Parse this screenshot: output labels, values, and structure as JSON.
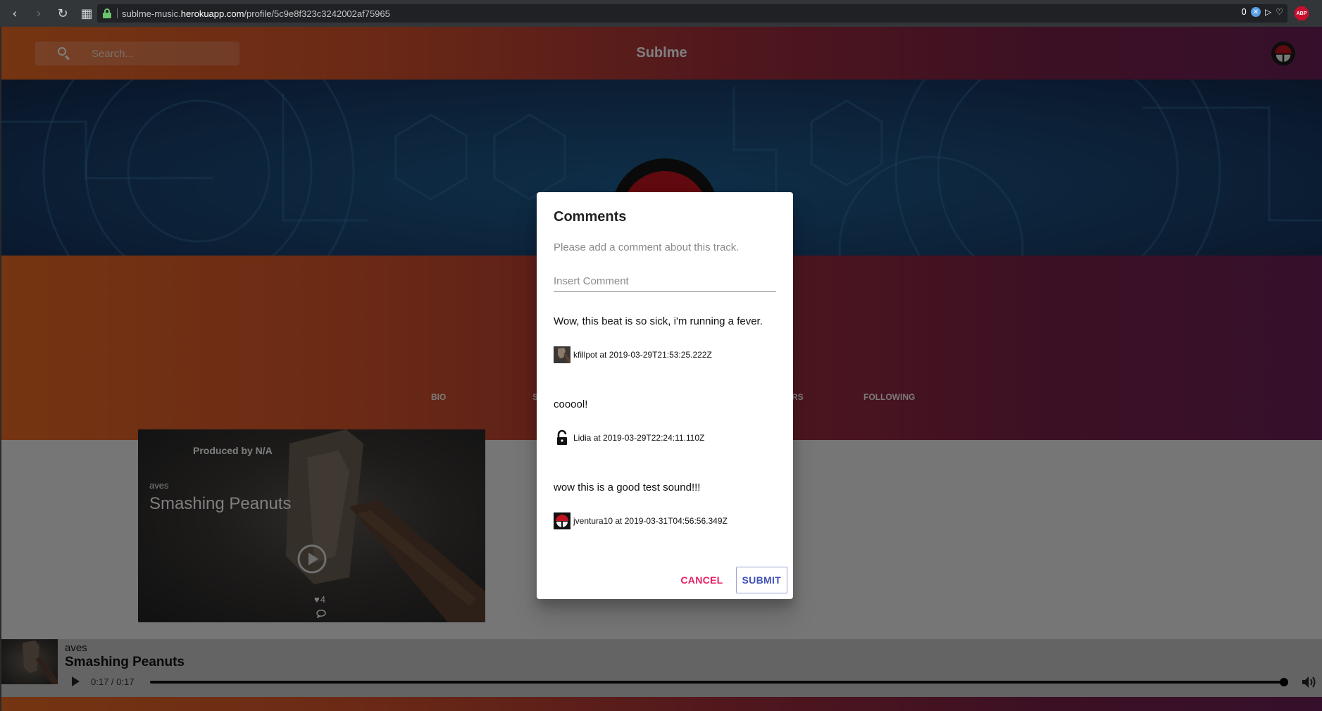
{
  "browser": {
    "url_prefix": "sublme-music.",
    "url_domain": "herokuapp.com",
    "url_path": "/profile/5c9e8f323c3242002af75965",
    "badge_count": "0",
    "abp_label": "ABP"
  },
  "header": {
    "search_placeholder": "Search...",
    "title": "Sublme"
  },
  "profile": {
    "tabs": [
      "BIO",
      "S",
      "RS",
      "FOLLOWING"
    ]
  },
  "track_card": {
    "produced_by": "Produced by N/A",
    "artist": "aves",
    "title": "Smashing Peanuts",
    "likes": "4"
  },
  "player": {
    "artist": "aves",
    "title": "Smashing Peanuts",
    "time": "0:17 / 0:17",
    "progress": 1.0
  },
  "dialog": {
    "title": "Comments",
    "text": "Please add a comment about this track.",
    "input_placeholder": "Insert Comment",
    "comments": [
      {
        "text": "Wow, this beat is so sick, i'm running a fever.",
        "meta": "kfillpot at 2019-03-29T21:53:25.222Z",
        "avatar": "hammer-thumb"
      },
      {
        "text": "cooool!",
        "meta": "Lidia at 2019-03-29T22:24:11.110Z",
        "avatar": "lock-icon"
      },
      {
        "text": "wow this is a good test sound!!!",
        "meta": "jventura10 at 2019-03-31T04:56:56.349Z",
        "avatar": "uchiha-crest"
      }
    ],
    "cancel_label": "CANCEL",
    "submit_label": "SUBMIT"
  },
  "colors": {
    "accent_cancel": "#e91e63",
    "accent_submit": "#3f51b5",
    "gradient_start": "#ea6a24",
    "gradient_end": "#6b1f56"
  }
}
